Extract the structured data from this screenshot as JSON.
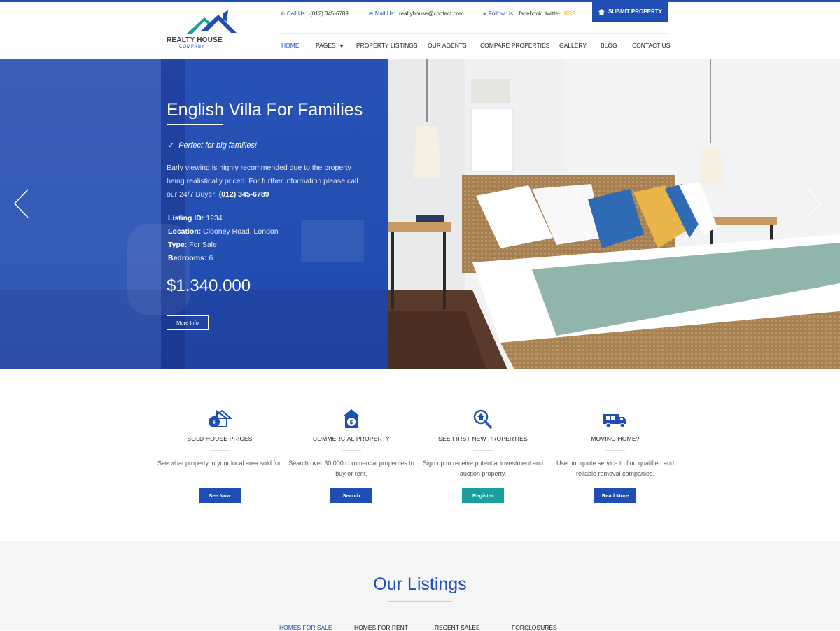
{
  "brand": {
    "name": "REALTY HOUSE",
    "sub": "COMPANY",
    "colors": {
      "primary": "#1f4fb4",
      "teal": "#1b9f9a",
      "rss": "#f0a920"
    }
  },
  "topbar": {
    "call_label": "Call Us:",
    "call_value": "(012) 345-6789",
    "mail_label": "Mail Us:",
    "mail_value": "realtyhouse@contact.com",
    "follow_label": "Follow Us:",
    "social": [
      "facebook",
      "twitter",
      "RSS"
    ],
    "submit_label": "SUBMIT PROPERTY"
  },
  "nav": {
    "items": [
      "HOME",
      "PAGES",
      "PROPERTY LISTINGS",
      "OUR AGENTS",
      "COMPARE PROPERTIES",
      "GALLERY",
      "BLOG",
      "CONTACT US"
    ],
    "active": "HOME"
  },
  "hero": {
    "title": "English Villa For Families",
    "tagline": "Perfect for big families!",
    "description": "Early viewing is highly recommended due to the property being realistically priced. For further information please call our 24/7 Buyer:",
    "phone": "(012) 345-6789",
    "details": [
      {
        "label": "Listing ID:",
        "value": "1234"
      },
      {
        "label": "Location:",
        "value": "Clooney Road, London"
      },
      {
        "label": "Type:",
        "value": "For Sale"
      },
      {
        "label": "Bedrooms:",
        "value": "6"
      }
    ],
    "price": "$1.340.000",
    "button": "More Info"
  },
  "features": [
    {
      "icon": "sold-house-icon",
      "title": "SOLD HOUSE PRICES",
      "text": "See what property in your local area sold for.",
      "button": "See Now"
    },
    {
      "icon": "house-dollar-icon",
      "title": "COMMERCIAL PROPERTY",
      "text": "Search over 30,000 commercial properties to buy or rent.",
      "button": "Search"
    },
    {
      "icon": "magnifier-house-icon",
      "title": "SEE FIRST NEW PROPERTIES",
      "text": "Sign up to receive potential investment and auction property.",
      "button": "Register"
    },
    {
      "icon": "moving-truck-icon",
      "title": "MOVING HOME?",
      "text": "Use our quote service to find qualified and reliable removal companies.",
      "button": "Read More"
    }
  ],
  "listings": {
    "title": "Our Listings",
    "tabs": [
      "HOMES FOR SALE",
      "HOMES FOR RENT",
      "RECENT SALES",
      "FORCLOSURES"
    ]
  }
}
